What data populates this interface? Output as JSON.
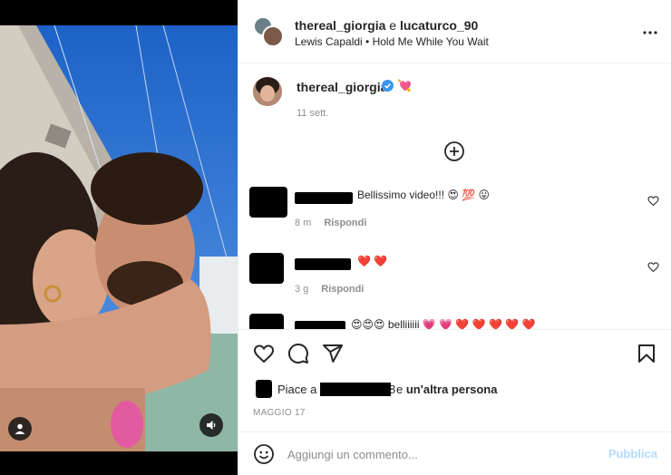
{
  "header": {
    "user1": "thereal_giorgia",
    "separator": "e",
    "user2": "lucaturco_90",
    "music": "Lewis Capaldi • Hold Me While You Wait",
    "more_icon": "more-horizontal-icon"
  },
  "caption": {
    "username": "thereal_giorgia",
    "verified_icon": "verified-badge-icon",
    "emoji_icon": "heart-with-ribbon-icon",
    "time": "11 sett."
  },
  "load_more_icon": "plus-circle-icon",
  "comments": [
    {
      "text": "Bellissimo video!!! 😍 💯 😛",
      "time": "8 m",
      "reply": "Rispondi"
    },
    {
      "text": "❤️ ❤️",
      "time": "3 g",
      "reply": "Rispondi"
    },
    {
      "text": "😍😍😍 belliiiiii 💗 💗 ❤️ ❤️ ❤️ ❤️ ❤️"
    }
  ],
  "actions": {
    "like_icon": "heart-icon",
    "comment_icon": "comment-bubble-icon",
    "share_icon": "paper-plane-icon",
    "save_icon": "bookmark-icon"
  },
  "likes": {
    "prefix": "Piace a",
    "digit": "8",
    "connector": "e",
    "other": "un'altra persona"
  },
  "date": "MAGGIO 17",
  "add_comment": {
    "placeholder": "Aggiungi un commento...",
    "publish": "Pubblica",
    "emoji_icon": "smiley-icon"
  },
  "colors": {
    "verified": "#3897f0",
    "publish_disabled": "#b3dbff",
    "heart_red": "#e0245e"
  }
}
